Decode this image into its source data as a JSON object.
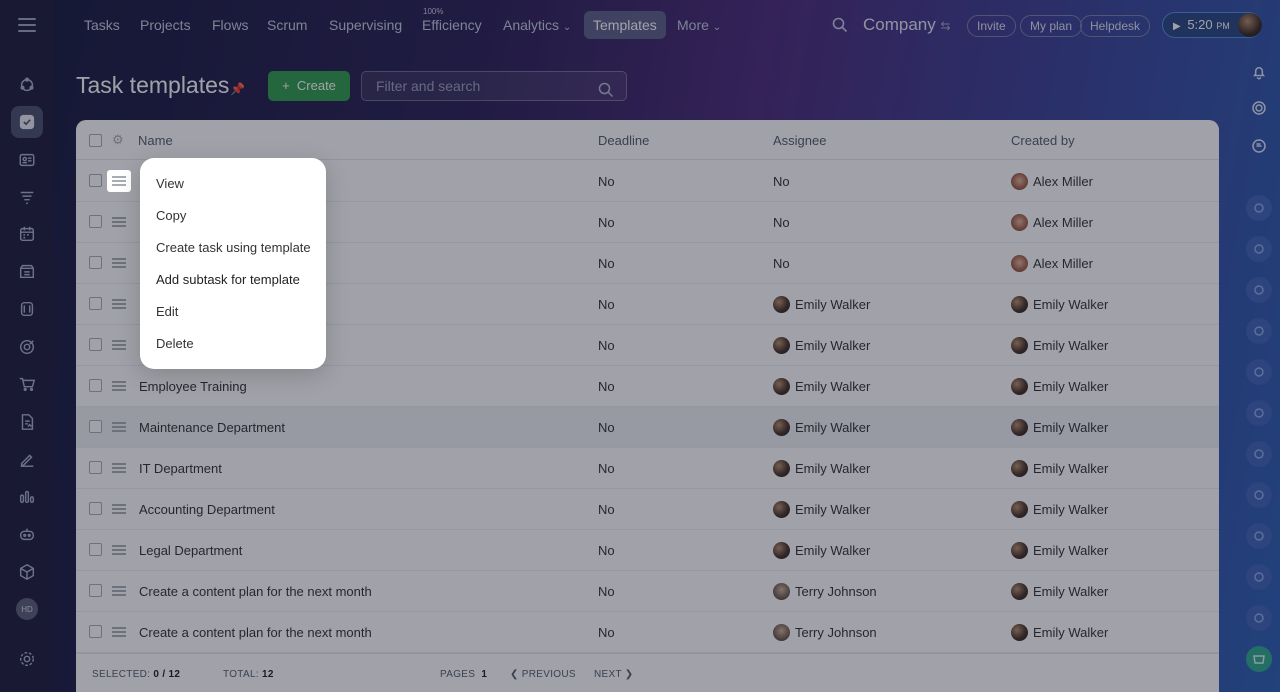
{
  "nav": {
    "items": [
      "Tasks",
      "Projects",
      "Flows",
      "Scrum",
      "Supervising",
      "Efficiency",
      "Analytics",
      "Templates",
      "More"
    ],
    "efficiency_badge": "100%",
    "analytics_chevron": "chevron-down-icon",
    "more_chevron": "chevron-down-icon",
    "company": "Company",
    "invite": "Invite",
    "my_plan": "My plan",
    "helpdesk": "Helpdesk",
    "time": "5:20",
    "time_suffix": "PM"
  },
  "sidebar": {
    "icons": [
      "crm-icon",
      "tasks-icon",
      "contact-card-icon",
      "filter-icon",
      "calendar-icon",
      "store-icon",
      "disk-icon",
      "target-icon",
      "cart-icon",
      "document-icon",
      "sign-icon",
      "analytics-icon",
      "robot-icon",
      "box-icon"
    ],
    "user_initials": "HD",
    "settings_icon": "gear-icon"
  },
  "page": {
    "title": "Task templates",
    "create_label": "Create",
    "search_placeholder": "Filter and search"
  },
  "table": {
    "columns": {
      "name": "Name",
      "deadline": "Deadline",
      "assignee": "Assignee",
      "created_by": "Created by"
    },
    "rows": [
      {
        "name": "",
        "deadline": "No",
        "assignee": "No",
        "assignee_avatar": "",
        "created_by": "Alex Miller",
        "created_avatar": "alex"
      },
      {
        "name": "",
        "deadline": "No",
        "assignee": "No",
        "assignee_avatar": "",
        "created_by": "Alex Miller",
        "created_avatar": "alex"
      },
      {
        "name": "",
        "deadline": "No",
        "assignee": "No",
        "assignee_avatar": "",
        "created_by": "Alex Miller",
        "created_avatar": "alex"
      },
      {
        "name": "",
        "deadline": "No",
        "assignee": "Emily Walker",
        "assignee_avatar": "emily",
        "created_by": "Emily Walker",
        "created_avatar": "emily"
      },
      {
        "name": "",
        "deadline": "No",
        "assignee": "Emily Walker",
        "assignee_avatar": "emily",
        "created_by": "Emily Walker",
        "created_avatar": "emily"
      },
      {
        "name": "Employee Training",
        "deadline": "No",
        "assignee": "Emily Walker",
        "assignee_avatar": "emily",
        "created_by": "Emily Walker",
        "created_avatar": "emily"
      },
      {
        "name": "Maintenance Department",
        "deadline": "No",
        "assignee": "Emily Walker",
        "assignee_avatar": "emily",
        "created_by": "Emily Walker",
        "created_avatar": "emily"
      },
      {
        "name": "IT Department",
        "deadline": "No",
        "assignee": "Emily Walker",
        "assignee_avatar": "emily",
        "created_by": "Emily Walker",
        "created_avatar": "emily"
      },
      {
        "name": "Accounting Department",
        "deadline": "No",
        "assignee": "Emily Walker",
        "assignee_avatar": "emily",
        "created_by": "Emily Walker",
        "created_avatar": "emily"
      },
      {
        "name": "Legal Department",
        "deadline": "No",
        "assignee": "Emily Walker",
        "assignee_avatar": "emily",
        "created_by": "Emily Walker",
        "created_avatar": "emily"
      },
      {
        "name": "Create a content plan for the next month",
        "deadline": "No",
        "assignee": "Terry Johnson",
        "assignee_avatar": "terry",
        "created_by": "Emily Walker",
        "created_avatar": "emily"
      },
      {
        "name": "Create a content plan for the next month",
        "deadline": "No",
        "assignee": "Terry Johnson",
        "assignee_avatar": "terry",
        "created_by": "Emily Walker",
        "created_avatar": "emily"
      }
    ]
  },
  "footer": {
    "selected_label": "SELECTED:",
    "selected_value": "0 / 12",
    "total_label": "TOTAL:",
    "total_value": "12",
    "pages_label": "PAGES",
    "pages_value": "1",
    "previous": "PREVIOUS",
    "next": "NEXT"
  },
  "context_menu": {
    "items": [
      "View",
      "Copy",
      "Create task using template",
      "Add subtask for template",
      "Edit",
      "Delete"
    ],
    "highlighted": "Add subtask for template"
  },
  "colors": {
    "accent_green": "#2f9c4c",
    "nav_active": "#5c5f87",
    "timer_border": "#4f8de6"
  }
}
